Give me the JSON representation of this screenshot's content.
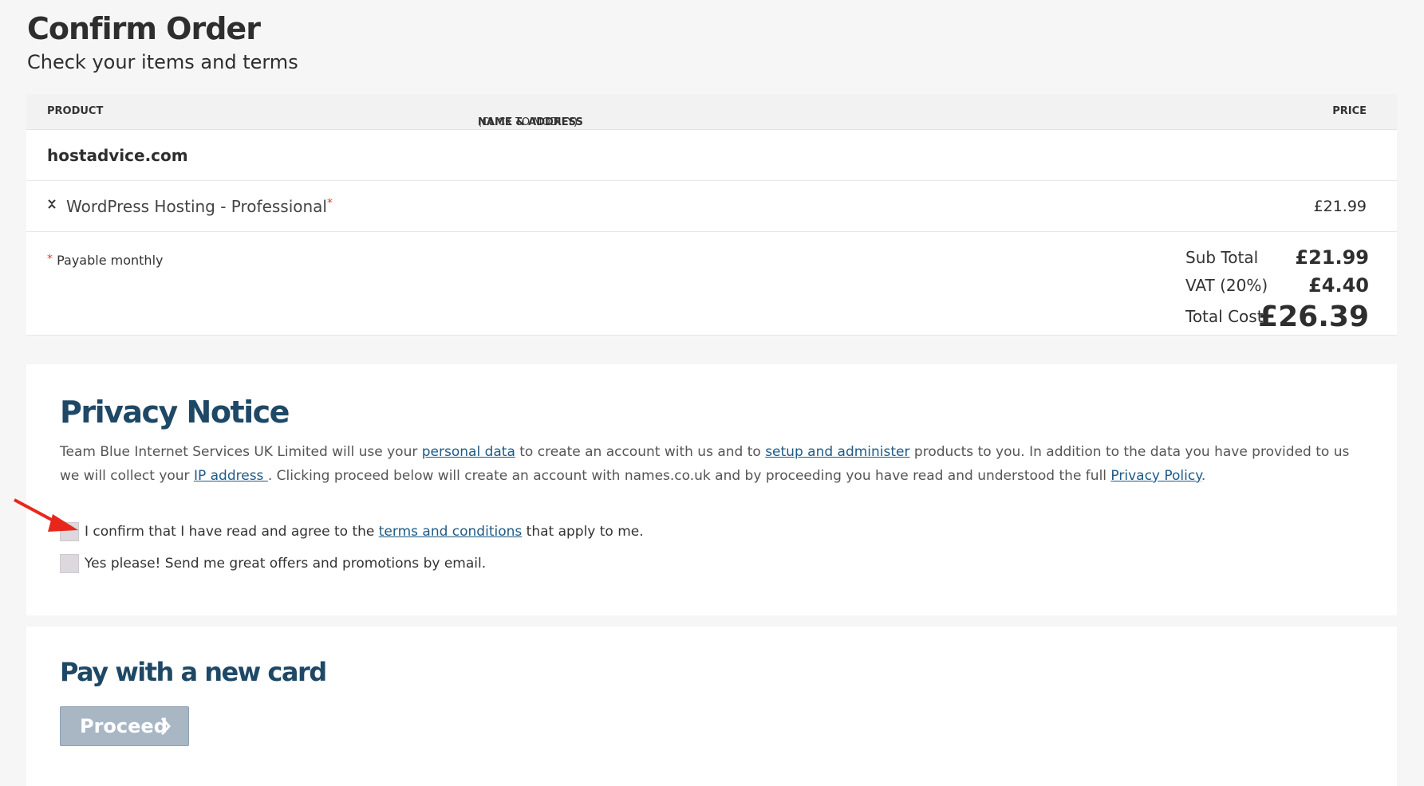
{
  "header": {
    "title": "Confirm Order",
    "subtitle": "Check your items and terms"
  },
  "order_table": {
    "columns": {
      "product": "PRODUCT",
      "name_address": "NAME & ADDRESS",
      "name_address_note": "(CLICK TO MODIFY)",
      "price": "PRICE"
    },
    "domain": "hostadvice.com",
    "items": [
      {
        "label": "WordPress Hosting - Professional",
        "marker": "*",
        "price": "£21.99",
        "icon": "collapse-icon"
      }
    ],
    "footnote_marker": "*",
    "footnote": "Payable monthly",
    "totals": {
      "subtotal_label": "Sub Total",
      "subtotal_value": "£21.99",
      "vat_label": "VAT (20%)",
      "vat_value": "£4.40",
      "total_label": "Total Cost",
      "total_value": "£26.39"
    }
  },
  "privacy": {
    "title": "Privacy Notice",
    "text": {
      "p1": "Team Blue Internet Services UK Limited will use your ",
      "link_personal_data": "personal data",
      "p2": " to create an account with us and to ",
      "link_setup": "setup and administer",
      "p3": " products to you. In addition to the data you have provided to us we will collect your ",
      "link_ip": "IP address ",
      "p4": ". Clicking proceed below will create an account with names.co.uk and by proceeding you have read and understood the full ",
      "link_privacy": "Privacy Policy",
      "p5": "."
    },
    "checkbox_terms": {
      "before": "I confirm that I have read and agree to the ",
      "link": "terms and conditions",
      "after": " that apply to me.",
      "checked": false
    },
    "checkbox_offers": {
      "label": "Yes please! Send me great offers and promotions by email.",
      "checked": false
    }
  },
  "payment": {
    "title": "Pay with a new card",
    "proceed_label": "Proceed",
    "proceed_icon": "chevron-right-icon"
  },
  "colors": {
    "section_title": "#1e4865",
    "link": "#1e5a87",
    "button_disabled": "#a9b6c4",
    "arrow": "#e8271c",
    "asterisk": "#e23c3c"
  }
}
